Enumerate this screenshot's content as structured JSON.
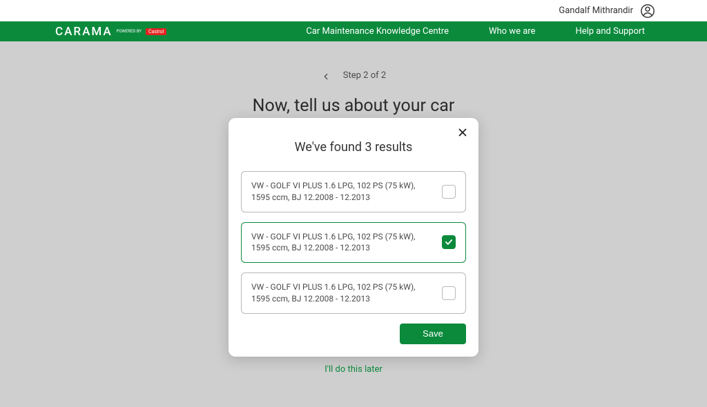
{
  "topbar": {
    "username": "Gandalf Mithrandir"
  },
  "navbar": {
    "logo": "CARAMA",
    "poweredBy": "POWERED BY",
    "brand": "Castrol",
    "links": [
      "Car Maintenance Knowledge Centre",
      "Who we are",
      "Help and Support"
    ]
  },
  "page": {
    "step": "Step 2 of 2",
    "title": "Now, tell us about your car",
    "laterLink": "I'll do this later"
  },
  "modal": {
    "title": "We've found 3 results",
    "results": [
      {
        "text": "VW - GOLF VI PLUS 1.6 LPG, 102 PS (75 kW), 1595 ccm, BJ 12.2008 - 12.2013",
        "selected": false
      },
      {
        "text": "VW - GOLF VI PLUS 1.6 LPG, 102 PS (75 kW), 1595 ccm, BJ 12.2008 - 12.2013",
        "selected": true
      },
      {
        "text": "VW - GOLF VI PLUS 1.6 LPG, 102 PS (75 kW), 1595 ccm, BJ 12.2008 - 12.2013",
        "selected": false
      }
    ],
    "saveLabel": "Save"
  },
  "colors": {
    "brandGreen": "#0b8a3c"
  }
}
